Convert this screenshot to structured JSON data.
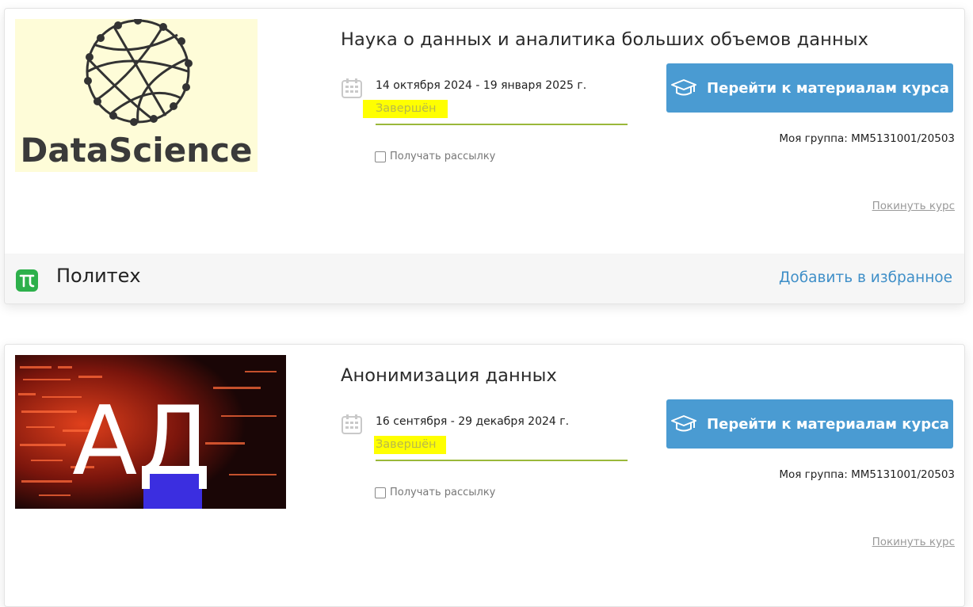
{
  "colors": {
    "accent_button": "#4a9bd2",
    "status_highlight": "#ffff00",
    "status_text": "#b8b84a",
    "status_underline": "#9ab83a",
    "link_blue": "#3f8fc8",
    "provider_logo": "#2db04b"
  },
  "courses": [
    {
      "image_text": "DataScience",
      "image_icon": "network-circle-icon",
      "title": "Наука о данных и аналитика больших объемов данных",
      "dates": "14 октября 2024 - 19 января 2025 г.",
      "status": "Завершён",
      "subscribe_label": "Получать рассылку",
      "button_label": "Перейти к материалам курса",
      "button_icon": "graduation-cap-icon",
      "group": "Моя группа: ММ5131001/20503",
      "leave_label": "Покинуть курс",
      "provider": "Политех",
      "favorite_label": "Добавить в избранное"
    },
    {
      "image_text": "АД",
      "title": "Анонимизация данных",
      "dates": "16 сентября - 29 декабря 2024 г.",
      "status": "Завершён",
      "subscribe_label": "Получать рассылку",
      "button_label": "Перейти к материалам курса",
      "button_icon": "graduation-cap-icon",
      "group": "Моя группа: ММ5131001/20503",
      "leave_label": "Покинуть курс"
    }
  ]
}
